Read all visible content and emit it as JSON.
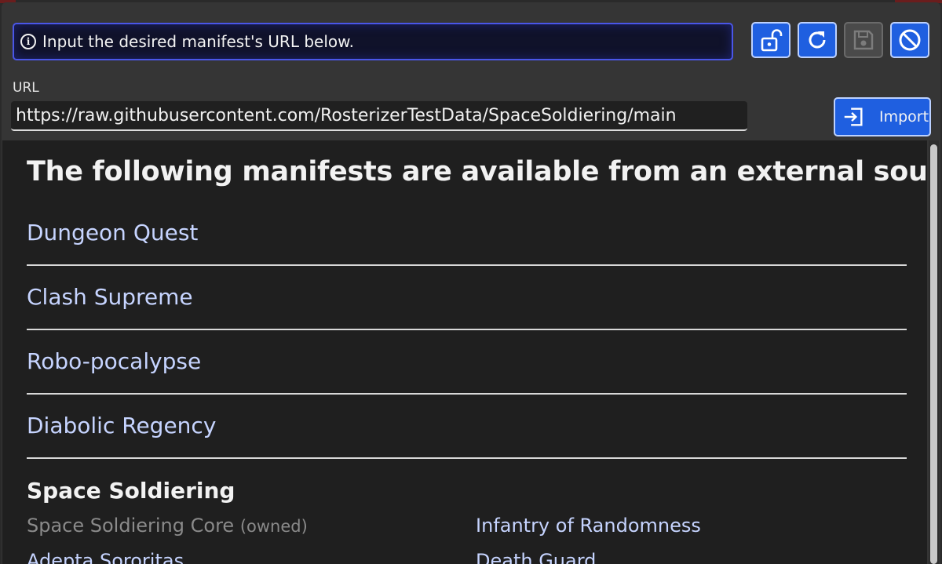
{
  "status": {
    "message": "Input the desired manifest's URL below."
  },
  "toolbar": {
    "buttons": [
      {
        "name": "unlock-button",
        "icon": "unlock-icon",
        "state": "enabled"
      },
      {
        "name": "refresh-button",
        "icon": "refresh-icon",
        "state": "enabled"
      },
      {
        "name": "save-button",
        "icon": "save-icon",
        "state": "disabled"
      },
      {
        "name": "cancel-button",
        "icon": "prohibit-icon",
        "state": "enabled"
      }
    ]
  },
  "url": {
    "label": "URL",
    "value": "https://raw.githubusercontent.com/RosterizerTestData/SpaceSoldiering/main"
  },
  "import": {
    "label": "Import",
    "icon": "import-icon"
  },
  "content": {
    "heading": "The following manifests are available from an external source.",
    "manifests": [
      "Dungeon Quest",
      "Clash Supreme",
      "Robo-pocalypse",
      "Diabolic Regency"
    ],
    "group": {
      "title": "Space Soldiering",
      "items": [
        {
          "label": "Space Soldiering Core",
          "tag": "(owned)",
          "owned": true
        },
        {
          "label": "Infantry of Randomness",
          "owned": false
        },
        {
          "label": "Adepta Sororitas",
          "owned": false
        },
        {
          "label": "Death Guard",
          "owned": false
        }
      ]
    }
  },
  "colors": {
    "accent": "#1f5fe0",
    "link": "#c6d4ff",
    "owned": "#8a8a8a",
    "background": "#1f1f1f"
  }
}
